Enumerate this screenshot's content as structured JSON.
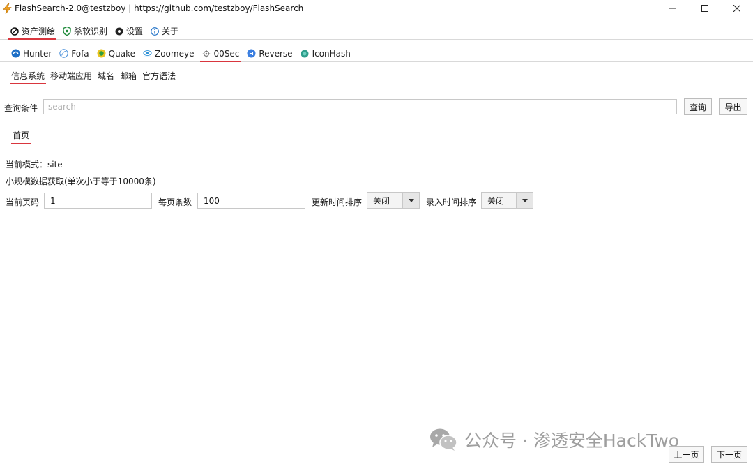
{
  "window": {
    "title": "FlashSearch-2.0@testzboy | https://github.com/testzboy/FlashSearch"
  },
  "main_tabs": [
    {
      "label": "资产测绘",
      "icon": "compass-icon"
    },
    {
      "label": "杀软识别",
      "icon": "shield-icon"
    },
    {
      "label": "设置",
      "icon": "gear-icon"
    },
    {
      "label": "关于",
      "icon": "info-icon"
    }
  ],
  "engine_tabs": [
    {
      "label": "Hunter",
      "icon": "hunter-icon",
      "color": "#1d6fc6"
    },
    {
      "label": "Fofa",
      "icon": "fofa-icon",
      "color": "#4a90d9"
    },
    {
      "label": "Quake",
      "icon": "quake-icon",
      "color": "#2e9e3e"
    },
    {
      "label": "Zoomeye",
      "icon": "zoomeye-icon",
      "color": "#2a8fd6"
    },
    {
      "label": "00Sec",
      "icon": "gear-outline-icon",
      "color": "#777777"
    },
    {
      "label": "Reverse",
      "icon": "reverse-icon",
      "color": "#3a7ee0"
    },
    {
      "label": "IconHash",
      "icon": "iconhash-icon",
      "color": "#2f9e8c"
    }
  ],
  "sub_tabs": [
    {
      "label": "信息系统"
    },
    {
      "label": "移动端应用"
    },
    {
      "label": "域名"
    },
    {
      "label": "邮箱"
    },
    {
      "label": "官方语法"
    }
  ],
  "query": {
    "label": "查询条件",
    "placeholder": "search",
    "value": "",
    "query_button": "查询",
    "export_button": "导出"
  },
  "page_tab": {
    "label": "首页"
  },
  "mode_text": "当前模式：site",
  "small_text": "小规模数据获取(单次小于等于10000条)",
  "filters": {
    "page_label": "当前页码",
    "page_value": "1",
    "per_page_label": "每页条数",
    "per_page_value": "100",
    "update_sort_label": "更新时间排序",
    "update_sort_value": "关闭",
    "entry_sort_label": "录入时间排序",
    "entry_sort_value": "关闭"
  },
  "pagination": {
    "prev_label": "上一页",
    "next_label": "下一页"
  },
  "watermark": {
    "text": "公众号 · 渗透安全HackTwo",
    "icon": "wechat-icon"
  },
  "colors": {
    "accent": "#d9363e",
    "title_icon": "#f0a020"
  }
}
